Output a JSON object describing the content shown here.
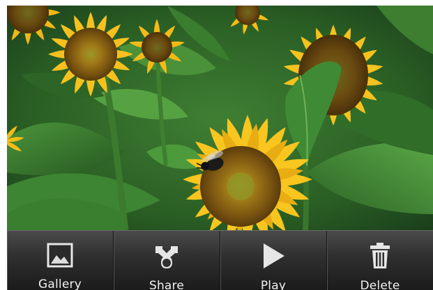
{
  "photo": {
    "subject": "sunflower-with-bee",
    "colors": {
      "petal": "#f7c21a",
      "center": "#8a6a10",
      "foliage": "#2f6b2a",
      "bee": "#1a1a1a"
    }
  },
  "toolbar": {
    "items": [
      {
        "label": "Gallery",
        "icon": "gallery-icon"
      },
      {
        "label": "Share",
        "icon": "share-icon"
      },
      {
        "label": "Play",
        "icon": "play-icon"
      },
      {
        "label": "Delete",
        "icon": "trash-icon"
      }
    ]
  }
}
